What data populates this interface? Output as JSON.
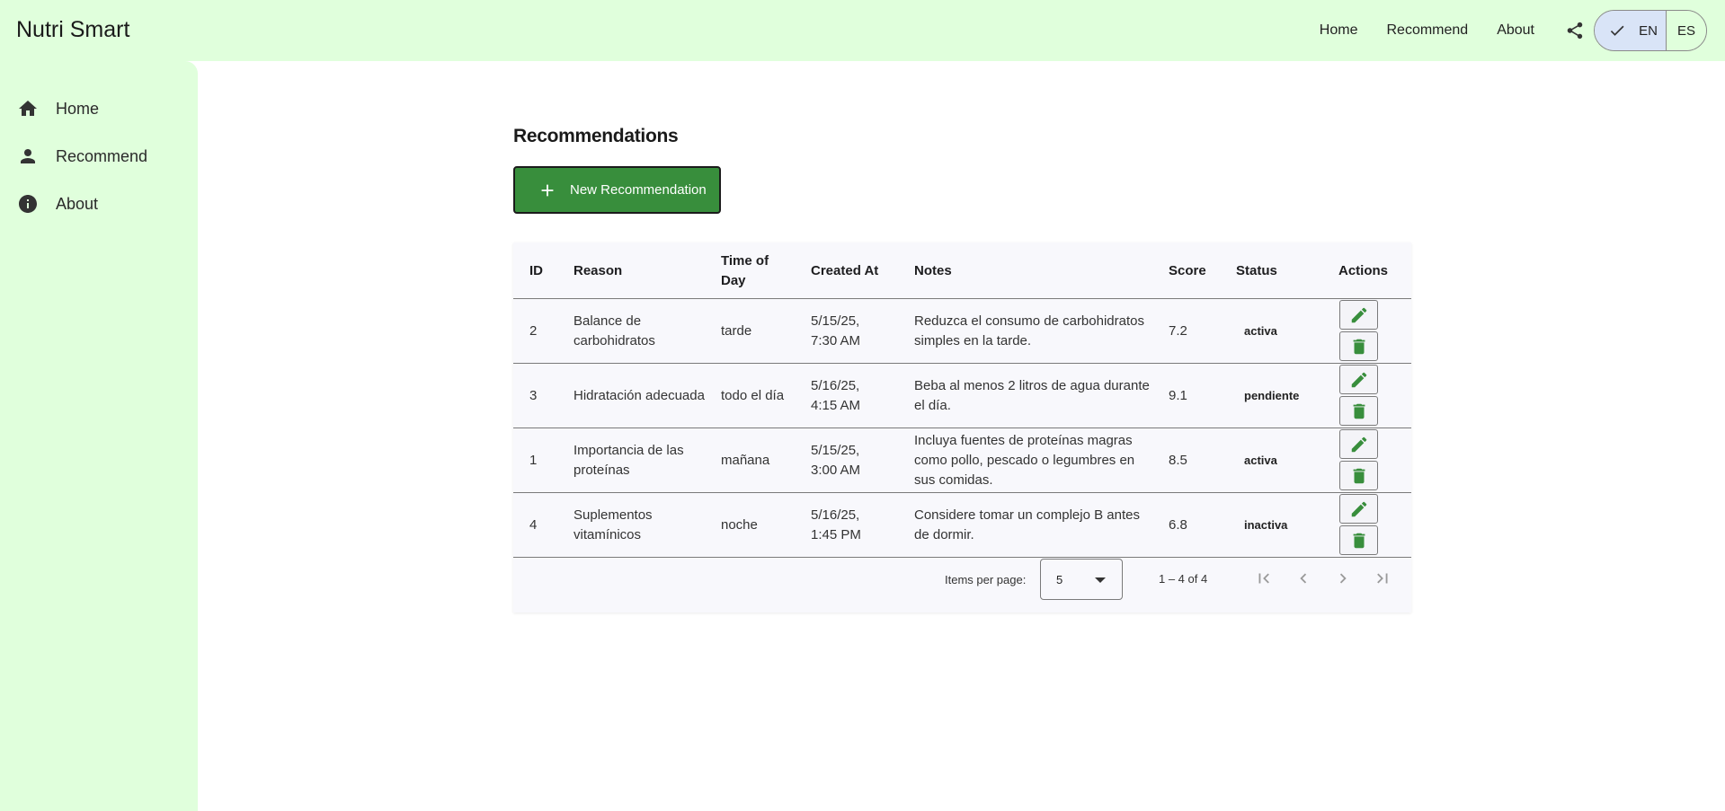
{
  "app": {
    "title": "Nutri Smart"
  },
  "header": {
    "nav": [
      "Home",
      "Recommend",
      "About"
    ],
    "languages": {
      "en": "EN",
      "es": "ES",
      "selected": "EN"
    }
  },
  "sidebar": {
    "items": [
      {
        "label": "Home",
        "icon": "home-icon"
      },
      {
        "label": "Recommend",
        "icon": "person-icon"
      },
      {
        "label": "About",
        "icon": "info-icon"
      }
    ]
  },
  "main": {
    "heading": "Recommendations",
    "new_button": "New Recommendation"
  },
  "table": {
    "columns": [
      "ID",
      "Reason",
      "Time of Day",
      "Created At",
      "Notes",
      "Score",
      "Status",
      "Actions"
    ],
    "rows": [
      {
        "id": "2",
        "reason": "Balance de carbohidratos",
        "time": "tarde",
        "created": "5/15/25, 7:30 AM",
        "notes": "Reduzca el consumo de carbohidratos simples en la tarde.",
        "score": "7.2",
        "status": "activa"
      },
      {
        "id": "3",
        "reason": "Hidratación adecuada",
        "time": "todo el día",
        "created": "5/16/25, 4:15 AM",
        "notes": "Beba al menos 2 litros de agua durante el día.",
        "score": "9.1",
        "status": "pendiente"
      },
      {
        "id": "1",
        "reason": "Importancia de las proteínas",
        "time": "mañana",
        "created": "5/15/25, 3:00 AM",
        "notes": "Incluya fuentes de proteínas magras como pollo, pescado o legumbres en sus comidas.",
        "score": "8.5",
        "status": "activa"
      },
      {
        "id": "4",
        "reason": "Suplementos vitamínicos",
        "time": "noche",
        "created": "5/16/25, 1:45 PM",
        "notes": "Considere tomar un complejo B antes de dormir.",
        "score": "6.8",
        "status": "inactiva"
      }
    ]
  },
  "paginator": {
    "items_per_page_label": "Items per page:",
    "items_per_page": "5",
    "range": "1 – 4 of 4"
  },
  "colors": {
    "toolbar_bg": "#e0ffdc",
    "accent_green": "#388e3c",
    "selected_lang_bg": "#d9e4f7"
  }
}
